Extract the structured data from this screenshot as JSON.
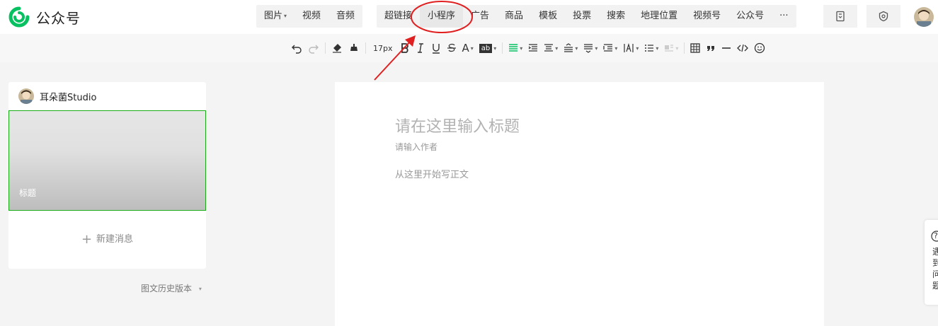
{
  "app": {
    "title": "公众号"
  },
  "menu": {
    "group1": [
      {
        "label": "图片",
        "caret": "▾"
      },
      {
        "label": "视频"
      },
      {
        "label": "音频"
      }
    ],
    "group2": [
      {
        "label": "超链接"
      },
      {
        "label": "小程序"
      },
      {
        "label": "广告"
      },
      {
        "label": "商品"
      },
      {
        "label": "模板"
      },
      {
        "label": "投票"
      },
      {
        "label": "搜索"
      },
      {
        "label": "地理位置"
      },
      {
        "label": "视频号"
      },
      {
        "label": "公众号"
      },
      {
        "label": "···"
      }
    ]
  },
  "toolbar": {
    "font_size": "17px",
    "font_color_letter": "A",
    "bg_color_label": "ab"
  },
  "account": {
    "name": "耳朵菌Studio"
  },
  "article": {
    "cover_title": "标题"
  },
  "new_message": {
    "plus": "+",
    "label": "新建消息"
  },
  "history": {
    "label": "图文历史版本",
    "caret": "▾"
  },
  "editor": {
    "title_placeholder": "请在这里输入标题",
    "author_placeholder": "请输入作者",
    "body_placeholder": "从这里开始写正文"
  },
  "help_panel": {
    "icon": "?",
    "text": "遇到问题"
  },
  "colors": {
    "accent": "#07c160",
    "annotation": "#e02020",
    "selected_border": "#1aad19"
  }
}
